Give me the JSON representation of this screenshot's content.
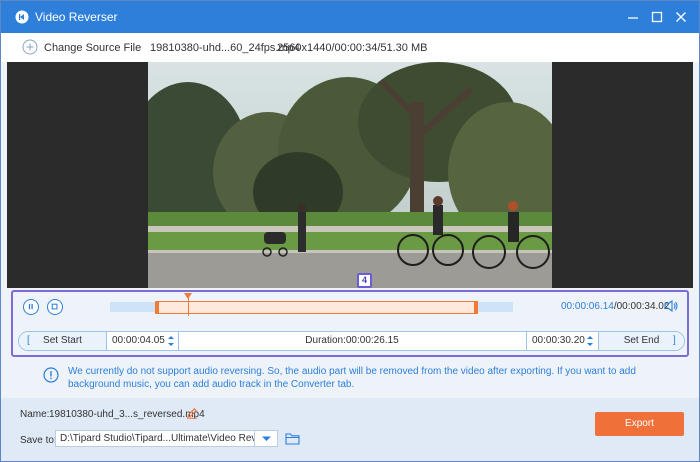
{
  "window": {
    "title": "Video Reverser",
    "accent_color": "#2d7fd9",
    "export_color": "#f0703a"
  },
  "source": {
    "change_label": "Change Source File",
    "file_name": "19810380-uhd...60_24fps.mp4",
    "file_info": "2560x1440/00:00:34/51.30 MB"
  },
  "preview": {
    "badge": "4"
  },
  "playback": {
    "current_time": "00:00:06.14",
    "total_time": "/00:00:34.02",
    "selection_start_fraction": 0.12,
    "selection_end_fraction": 0.89,
    "playhead_fraction": 0.18
  },
  "trim": {
    "set_start_label": "Set Start",
    "start_time": "00:00:04.05",
    "duration": "Duration:00:00:26.15",
    "end_time": "00:00:30.20",
    "set_end_label": "Set End",
    "bracket_left": "[",
    "bracket_right": "]"
  },
  "notice": {
    "text": "We currently do not support audio reversing. So, the audio part will be removed from the video after exporting. If you want to add background music, you can add audio track in the Converter tab."
  },
  "output": {
    "name_label": "Name:",
    "name_value": "19810380-uhd_3...s_reversed.mp4",
    "save_label": "Save to:",
    "save_path": "D:\\Tipard Studio\\Tipard...Ultimate\\Video Reverser",
    "export_label": "Export"
  },
  "icons": {
    "app": "app-logo-icon",
    "minimize": "minimize-icon",
    "maximize": "maximize-icon",
    "close": "close-icon",
    "add": "plus-icon",
    "pause": "pause-icon",
    "stop": "stop-icon",
    "volume": "volume-icon",
    "info": "info-icon",
    "edit": "pencil-icon",
    "folder": "folder-icon",
    "dropdown": "chevron-down-icon"
  }
}
